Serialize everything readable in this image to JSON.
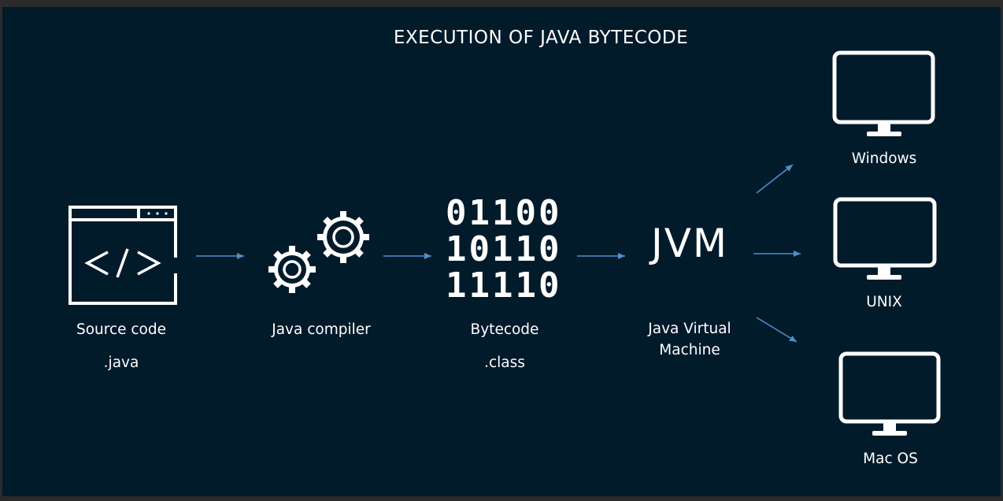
{
  "title": "EXECUTION OF JAVA BYTECODE",
  "colors": {
    "background": "#021b2b",
    "foreground": "#ffffff",
    "arrow": "#4e8fca"
  },
  "stages": {
    "source": {
      "label": "Source code",
      "sublabel": ".java",
      "icon": "code-window-icon"
    },
    "compiler": {
      "label": "Java compiler",
      "icon": "gears-icon"
    },
    "bytecode": {
      "label": "Bytecode",
      "sublabel": ".class",
      "bits": [
        "01100",
        "10110",
        "11110"
      ]
    },
    "jvm": {
      "text": "JVM",
      "label_line1": "Java Virtual",
      "label_line2": "Machine"
    }
  },
  "platforms": {
    "windows": {
      "label": "Windows",
      "icon": "monitor-icon"
    },
    "unix": {
      "label": "UNIX",
      "icon": "monitor-icon"
    },
    "macos": {
      "label": "Mac OS",
      "icon": "monitor-icon"
    }
  }
}
